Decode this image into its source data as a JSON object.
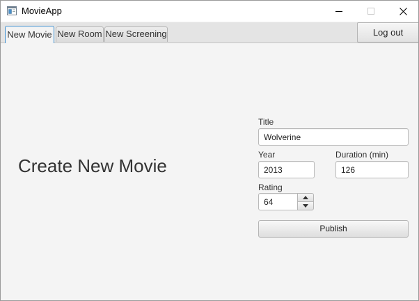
{
  "window": {
    "title": "MovieApp",
    "icon": "app-window-icon",
    "controls": [
      "minimize-icon",
      "maximize-icon",
      "close-icon"
    ]
  },
  "tabs": [
    {
      "label": "New Movie",
      "selected": true
    },
    {
      "label": "New Room",
      "selected": false
    },
    {
      "label": "New Screening",
      "selected": false
    }
  ],
  "toolbar": {
    "logout_label": "Log out"
  },
  "form": {
    "heading": "Create New Movie",
    "title_label": "Title",
    "title_value": "Wolverine",
    "year_label": "Year",
    "year_value": "2013",
    "duration_label": "Duration (min)",
    "duration_value": "126",
    "rating_label": "Rating",
    "rating_value": "64",
    "publish_label": "Publish"
  },
  "colors": {
    "accent": "#3e8fcf",
    "background": "#f4f4f4"
  }
}
